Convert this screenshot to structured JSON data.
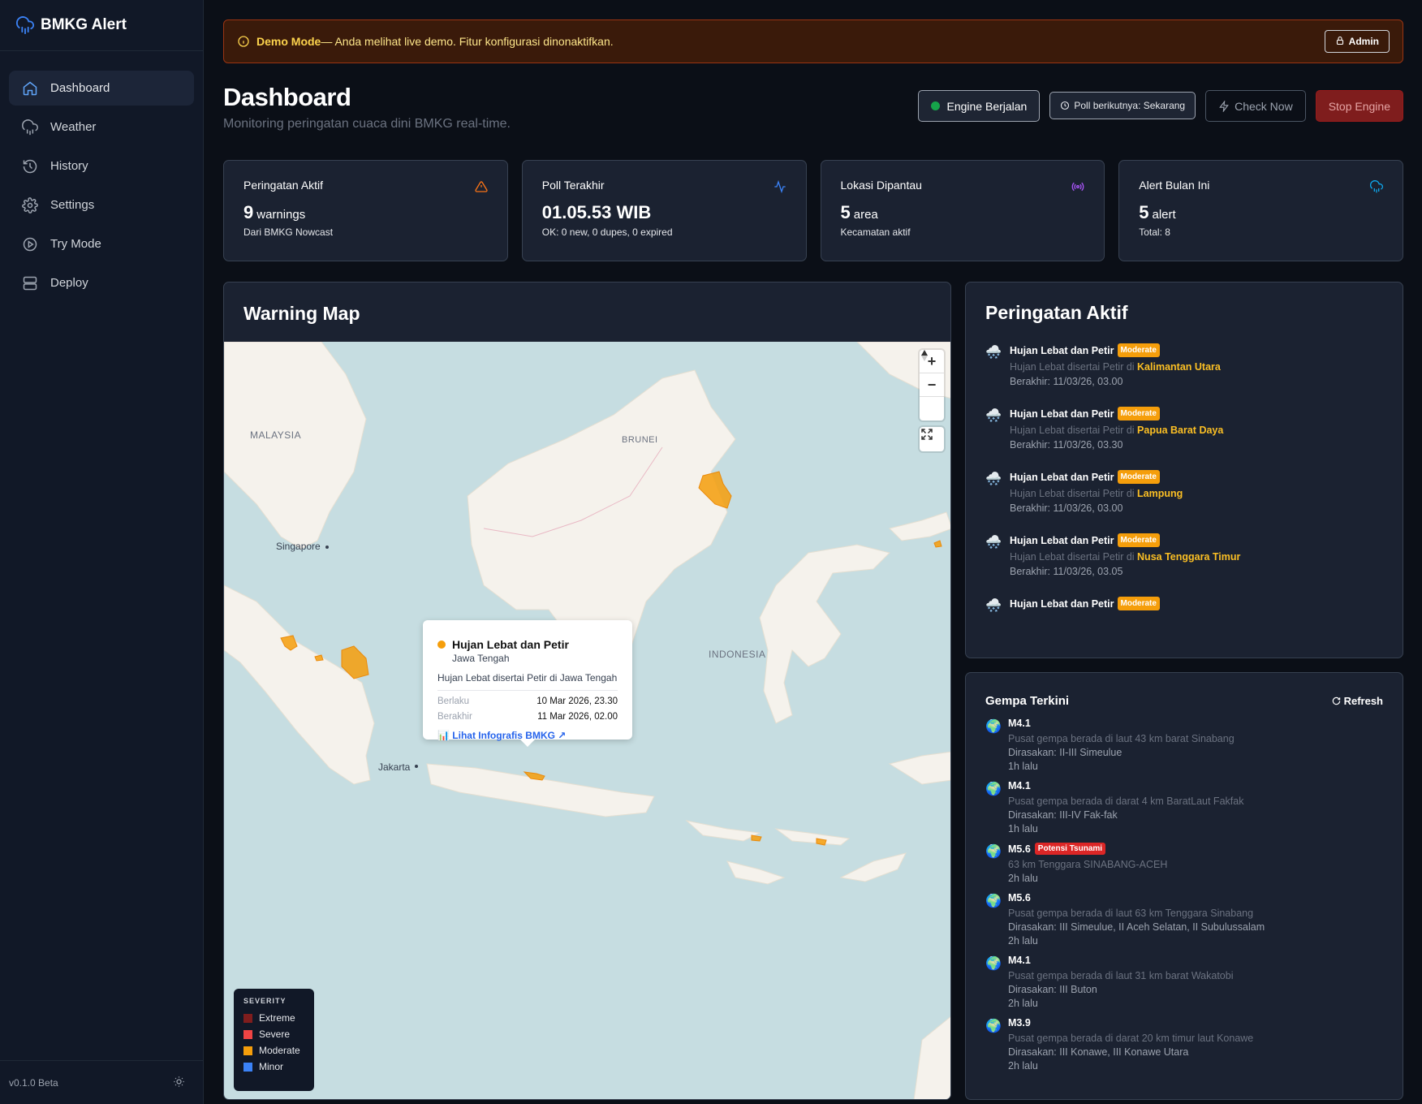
{
  "app": {
    "name": "BMKG Alert",
    "version": "v0.1.0 Beta"
  },
  "sidebar": {
    "items": [
      {
        "label": "Dashboard",
        "icon": "home-icon"
      },
      {
        "label": "Weather",
        "icon": "cloud-rain-icon"
      },
      {
        "label": "History",
        "icon": "history-icon"
      },
      {
        "label": "Settings",
        "icon": "gear-icon"
      },
      {
        "label": "Try Mode",
        "icon": "play-circle-icon"
      },
      {
        "label": "Deploy",
        "icon": "server-icon"
      }
    ]
  },
  "banner": {
    "title": "Demo Mode",
    "text": " — Anda melihat live demo. Fitur konfigurasi dinonaktifkan.",
    "admin_label": "Admin"
  },
  "header": {
    "title": "Dashboard",
    "subtitle": "Monitoring peringatan cuaca dini BMKG real-time.",
    "engine_label": "Engine Berjalan",
    "poll_label": "Poll berikutnya: Sekarang",
    "check_label": "Check Now",
    "stop_label": "Stop Engine"
  },
  "stats": [
    {
      "label": "Peringatan Aktif",
      "value": "9",
      "unit": "warnings",
      "sub": "Dari BMKG Nowcast",
      "icon": "alert-triangle-icon",
      "color": "#f97316"
    },
    {
      "label": "Poll Terakhir",
      "value": "01.05.53 WIB",
      "unit": "",
      "sub": "OK: 0 new, 0 dupes, 0 expired",
      "icon": "activity-icon",
      "color": "#3b82f6"
    },
    {
      "label": "Lokasi Dipantau",
      "value": "5",
      "unit": "area",
      "sub": "Kecamatan aktif",
      "icon": "radio-icon",
      "color": "#a855f7"
    },
    {
      "label": "Alert Bulan Ini",
      "value": "5",
      "unit": "alert",
      "sub": "Total: 8",
      "icon": "cloud-icon",
      "color": "#0ea5e9"
    }
  ],
  "map": {
    "title": "Warning Map",
    "labels": {
      "malaysia": "MALAYSIA",
      "brunei": "BRUNEI",
      "singapore": "Singapore",
      "indonesia": "INDONESIA",
      "jakarta": "Jakarta"
    },
    "popup": {
      "title": "Hujan Lebat dan Petir",
      "region": "Jawa Tengah",
      "desc": "Hujan Lebat disertai Petir di Jawa Tengah",
      "start_label": "Berlaku",
      "start": "10 Mar 2026, 23.30",
      "end_label": "Berakhir",
      "end": "11 Mar 2026, 02.00",
      "link": "📊 Lihat Infografis BMKG ↗"
    },
    "legend": {
      "title": "SEVERITY",
      "items": [
        {
          "label": "Extreme",
          "color": "#7f1d1d"
        },
        {
          "label": "Severe",
          "color": "#ef4444"
        },
        {
          "label": "Moderate",
          "color": "#f59e0b"
        },
        {
          "label": "Minor",
          "color": "#3b82f6"
        }
      ]
    }
  },
  "warnings": {
    "title": "Peringatan Aktif",
    "desc_prefix": "Hujan Lebat disertai Petir di ",
    "end_prefix": "Berakhir: ",
    "items": [
      {
        "title": "Hujan Lebat dan Petir",
        "severity": "Moderate",
        "region": "Kalimantan Utara",
        "end": "11/03/26, 03.00"
      },
      {
        "title": "Hujan Lebat dan Petir",
        "severity": "Moderate",
        "region": "Papua Barat Daya",
        "end": "11/03/26, 03.30"
      },
      {
        "title": "Hujan Lebat dan Petir",
        "severity": "Moderate",
        "region": "Lampung",
        "end": "11/03/26, 03.00"
      },
      {
        "title": "Hujan Lebat dan Petir",
        "severity": "Moderate",
        "region": "Nusa Tenggara Timur",
        "end": "11/03/26, 03.05"
      },
      {
        "title": "Hujan Lebat dan Petir",
        "severity": "Moderate"
      }
    ]
  },
  "quakes": {
    "title": "Gempa Terkini",
    "refresh_label": "Refresh",
    "items": [
      {
        "mag": "M4.1",
        "desc": "Pusat gempa berada di laut 43 km barat Sinabang",
        "felt": "Dirasakan: II-III Simeulue",
        "time": "1h lalu"
      },
      {
        "mag": "M4.1",
        "desc": "Pusat gempa berada di darat 4 km BaratLaut Fakfak",
        "felt": "Dirasakan: III-IV Fak-fak",
        "time": "1h lalu"
      },
      {
        "mag": "M5.6",
        "tsunami": "Potensi Tsunami",
        "desc": "63 km Tenggara SINABANG-ACEH",
        "time": "2h lalu"
      },
      {
        "mag": "M5.6",
        "desc": "Pusat gempa berada di laut 63 km Tenggara Sinabang",
        "felt": "Dirasakan: III Simeulue, II Aceh Selatan, II Subulussalam",
        "time": "2h lalu"
      },
      {
        "mag": "M4.1",
        "desc": "Pusat gempa berada di laut 31 km barat Wakatobi",
        "felt": "Dirasakan: III Buton",
        "time": "2h lalu"
      },
      {
        "mag": "M3.9",
        "desc": "Pusat gempa berada di darat 20 km timur laut Konawe",
        "felt": "Dirasakan: III Konawe, III Konawe Utara",
        "time": "2h lalu"
      }
    ]
  }
}
